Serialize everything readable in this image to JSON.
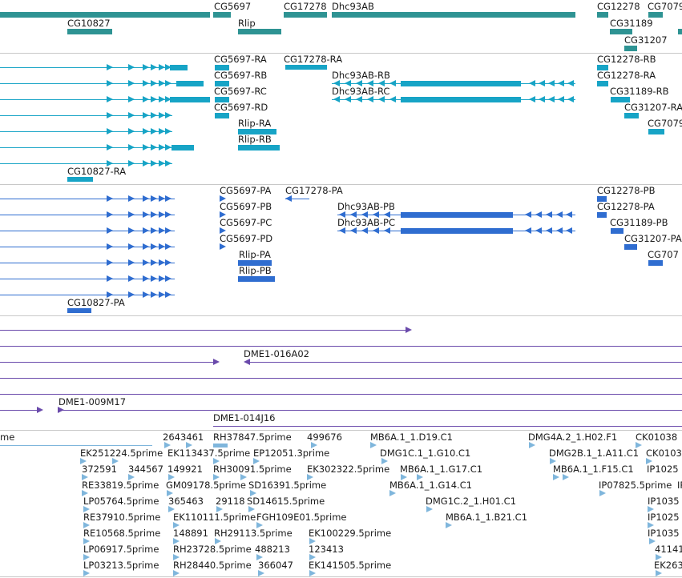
{
  "colors": {
    "gene": "#2e9393",
    "transcript": "#17a4c6",
    "protein": "#2f6dd0",
    "clone": "#6a4aab",
    "est": "#7fb6dc",
    "separator": "#c8c8c8"
  },
  "tracks": {
    "genes": [
      "CG5697",
      "CG17278",
      "Dhc93AB",
      "CG12278",
      "CG7079",
      "CG10827",
      "Rlip",
      "CG31189",
      "CG31207"
    ],
    "transcripts": [
      "CG5697-RA",
      "CG17278-RA",
      "CG12278-RB",
      "CG5697-RB",
      "Dhc93AB-RB",
      "CG12278-RA",
      "CG5697-RC",
      "Dhc93AB-RC",
      "CG31189-RB",
      "CG5697-RD",
      "CG31207-RA",
      "Rlip-RA",
      "CG7079",
      "Rlip-RB",
      "CG10827-RA"
    ],
    "proteins": [
      "CG5697-PA",
      "CG17278-PA",
      "CG12278-PB",
      "CG5697-PB",
      "Dhc93AB-PB",
      "CG12278-PA",
      "CG5697-PC",
      "Dhc93AB-PC",
      "CG31189-PB",
      "CG5697-PD",
      "CG31207-PA",
      "Rlip-PA",
      "CG707",
      "Rlip-PB",
      "CG10827-PA"
    ],
    "clones": [
      "DME1-016A02",
      "DME1-009M17",
      "DME1-014J16"
    ],
    "ests": [
      "me",
      "2643461",
      "RH37847.5prime",
      "499676",
      "MB6A.1_1.D19.C1",
      "DMG4A.2_1.H02.F1",
      "CK01038",
      "EK251224.5prime",
      "EK113437.5prime",
      "EP12051.3prime",
      "DMG1C.1_1.G10.C1",
      "DMG2B.1_1.A11.C1",
      "CK0103",
      "372591",
      "344567",
      "149921",
      "RH30091.5prime",
      "EK302322.5prime",
      "MB6A.1_1.G17.C1",
      "MB6A.1_1.F15.C1",
      "IP1025",
      "RE33819.5prime",
      "GM09178.5prime",
      "SD16391.5prime",
      "MB6A.1_1.G14.C1",
      "IP07825.5prime",
      "IP",
      "LP05764.5prime",
      "365463",
      "29118",
      "SD14615.5prime",
      "DMG1C.2_1.H01.C1",
      "IP1035",
      "RE37910.5prime",
      "EK110111.5prime",
      "FGH109E01.5prime",
      "MB6A.1_1.B21.C1",
      "IP1025",
      "RE10568.5prime",
      "148891",
      "RH29113.5prime",
      "EK100229.5prime",
      "IP1035",
      "LP06917.5prime",
      "RH23728.5prime",
      "488213",
      "123413",
      "41141",
      "LP03213.5prime",
      "RH28440.5prime",
      "366047",
      "EK141505.5prime",
      "EK263"
    ]
  }
}
